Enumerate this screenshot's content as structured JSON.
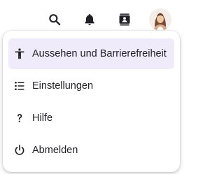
{
  "topbar": {
    "icons": [
      "search-icon",
      "bell-icon",
      "contacts-icon"
    ],
    "avatar": "user-avatar"
  },
  "menu": {
    "items": [
      {
        "label": "Aussehen und Barrierefreiheit",
        "icon": "accessibility-icon",
        "active": true
      },
      {
        "label": "Einstellungen",
        "icon": "list-settings-icon",
        "active": false
      },
      {
        "label": "Hilfe",
        "icon": "help-icon",
        "active": false
      },
      {
        "label": "Abmelden",
        "icon": "power-icon",
        "active": false
      }
    ]
  },
  "colors": {
    "active_background": "#efebfa",
    "text": "#1f1f24",
    "icon": "#1f1f24"
  }
}
